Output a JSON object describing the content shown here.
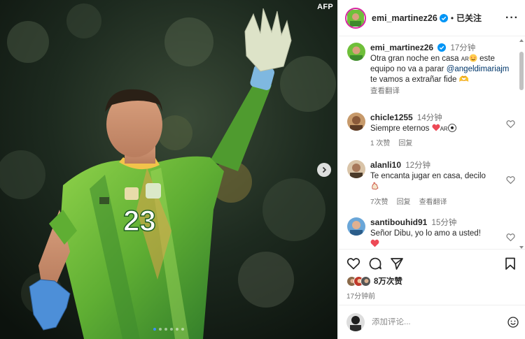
{
  "media": {
    "watermark": "AFP",
    "jersey_number": "23",
    "carousel": {
      "count": 6,
      "active_index": 0
    }
  },
  "header": {
    "username": "emi_martinez26",
    "separator": "•",
    "follow_status": "已关注",
    "more": "···"
  },
  "caption": {
    "username": "emi_martinez26",
    "time": "17分钟",
    "text_1": "Otra gran noche en casa ",
    "flag_text": "AR",
    "text_2": " este equipo no va a parar ",
    "mention": "@angeldimariajm",
    "text_3": " te vamos a extrañar fide",
    "trailing": " 🫶",
    "translate": "查看翻译"
  },
  "comments": [
    {
      "username": "chicle1255",
      "time": "14分钟",
      "text": "Siempre eternos ",
      "flag_text": "AR",
      "likes": "1 次赞",
      "reply": "回复",
      "translate": ""
    },
    {
      "username": "alanli10",
      "time": "12分钟",
      "text": "Te encanta jugar en casa, decilo",
      "likes": "7次赞",
      "reply": "回复",
      "translate": "查看翻译"
    },
    {
      "username": "santibouhid91",
      "time": "15分钟",
      "text": "Señor Dibu, yo lo amo a usted!",
      "likes": "",
      "reply": "",
      "translate": ""
    }
  ],
  "actions": {
    "likes": "8万次赞",
    "posted": "17分钟前"
  },
  "add_comment": {
    "placeholder": "添加评论..."
  },
  "colors": {
    "verified": "#0095f6",
    "heart_red": "#ed4956",
    "jersey_green": "#6fbf3a",
    "link": "#00376b"
  }
}
